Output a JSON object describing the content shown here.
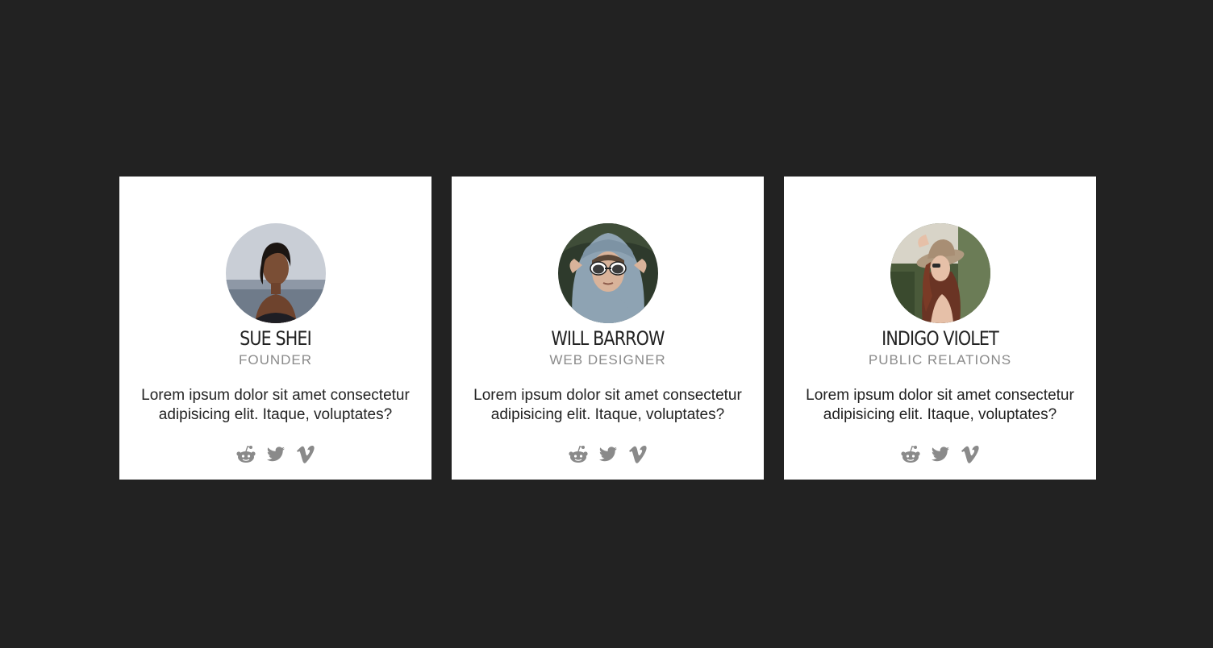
{
  "members": [
    {
      "name": "SUE SHEI",
      "role": "FOUNDER",
      "bio": "Lorem ipsum dolor sit amet consectetur adipisicing elit. Itaque, voluptates?",
      "photo": "woman-in-water-photo",
      "social": [
        "reddit-icon",
        "twitter-icon",
        "vimeo-icon"
      ]
    },
    {
      "name": "WILL BARROW",
      "role": "WEB DESIGNER",
      "bio": "Lorem ipsum dolor sit amet consectetur adipisicing elit. Itaque, voluptates?",
      "photo": "boy-with-sunglasses-photo",
      "social": [
        "reddit-icon",
        "twitter-icon",
        "vimeo-icon"
      ]
    },
    {
      "name": "INDIGO VIOLET",
      "role": "PUBLIC RELATIONS",
      "bio": "Lorem ipsum dolor sit amet consectetur adipisicing elit. Itaque, voluptates?",
      "photo": "woman-in-hat-photo",
      "social": [
        "reddit-icon",
        "twitter-icon",
        "vimeo-icon"
      ]
    }
  ],
  "colors": {
    "background": "#222222",
    "card": "#ffffff",
    "name": "#222222",
    "role": "#8a8a8a",
    "icon": "#8a8a8a"
  }
}
